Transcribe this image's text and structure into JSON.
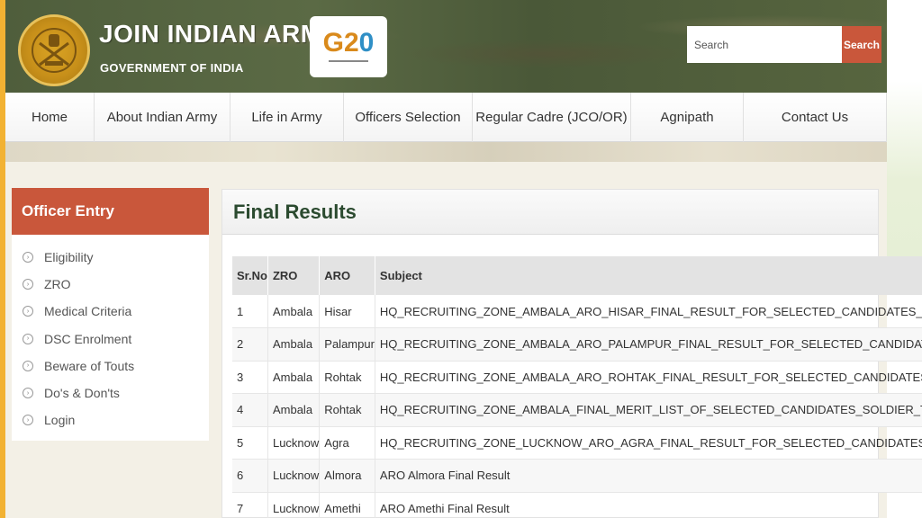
{
  "header": {
    "title": "JOIN INDIAN ARMY",
    "subtitle": "GOVERNMENT OF INDIA",
    "g20_logo": "G20",
    "search_placeholder": "Search",
    "search_button": "Search"
  },
  "nav": {
    "items": [
      {
        "label": "Home"
      },
      {
        "label": "About Indian Army"
      },
      {
        "label": "Life in Army"
      },
      {
        "label": "Officers Selection"
      },
      {
        "label": "Regular Cadre (JCO/OR)"
      },
      {
        "label": "Agnipath"
      },
      {
        "label": "Contact Us"
      }
    ]
  },
  "sidebar": {
    "heading": "Officer Entry",
    "items": [
      {
        "label": "Eligibility"
      },
      {
        "label": "ZRO"
      },
      {
        "label": "Medical Criteria"
      },
      {
        "label": "DSC Enrolment"
      },
      {
        "label": "Beware of Touts"
      },
      {
        "label": "Do's & Don'ts"
      },
      {
        "label": "Login"
      }
    ]
  },
  "main": {
    "title": "Final Results",
    "table": {
      "headers": [
        "Sr.No",
        "ZRO",
        "ARO",
        "Subject"
      ],
      "rows": [
        [
          "1",
          "Ambala",
          "Hisar",
          "HQ_RECRUITING_ZONE_AMBALA_ARO_HISAR_FINAL_RESULT_FOR_SELECTED_CANDIDATES_OF_AGNIVEER_GD_TE"
        ],
        [
          "2",
          "Ambala",
          "Palampur",
          "HQ_RECRUITING_ZONE_AMBALA_ARO_PALAMPUR_FINAL_RESULT_FOR_SELECTED_CANDIDATES_OF_AGNIVEER_GD"
        ],
        [
          "3",
          "Ambala",
          "Rohtak",
          "HQ_RECRUITING_ZONE_AMBALA_ARO_ROHTAK_FINAL_RESULT_FOR_SELECTED_CANDIDATES_OF_AGNIVEER_GD_T"
        ],
        [
          "4",
          "Ambala",
          "Rohtak",
          "HQ_RECRUITING_ZONE_AMBALA_FINAL_MERIT_LIST_OF_SELECTED_CANDIDATES_SOLDIER_TECHNICAL_NURSING_"
        ],
        [
          "5",
          "Lucknow",
          "Agra",
          "HQ_RECRUITING_ZONE_LUCKNOW_ARO_AGRA_FINAL_RESULT_FOR_SELECTED_CANDIDATES_OF_AGNIVEER_GD_T"
        ],
        [
          "6",
          "Lucknow",
          "Almora",
          "ARO Almora Final Result"
        ],
        [
          "7",
          "Lucknow",
          "Amethi",
          "ARO Amethi Final Result"
        ]
      ]
    }
  },
  "colors": {
    "accent": "#c9573b",
    "header_green": "#4f5e3c",
    "title_green": "#2b4a2f",
    "left_stripe": "#f2b233"
  }
}
